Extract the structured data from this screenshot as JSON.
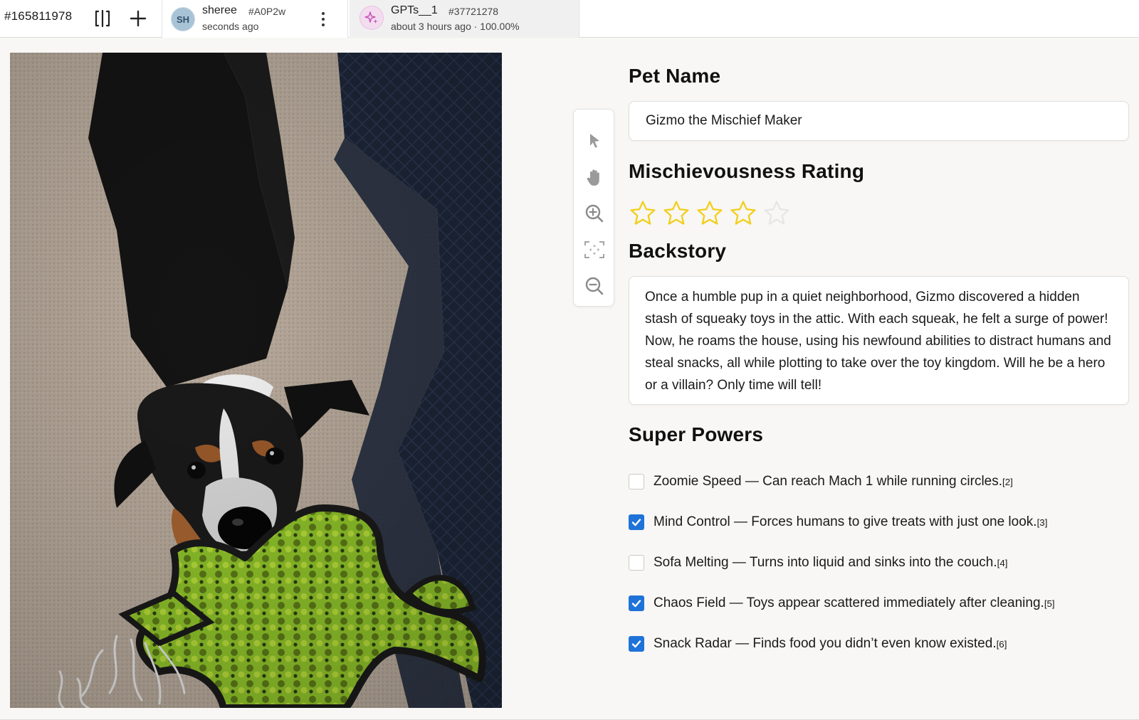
{
  "topbar": {
    "task_id": "#165811978",
    "icons": [
      "split-view-icon",
      "plus-icon"
    ],
    "tabs": [
      {
        "avatar": "SH",
        "name": "sheree",
        "hash": "#A0P2w",
        "subtitle": "seconds ago",
        "active": true
      },
      {
        "avatar_icon": "sparkle-icon",
        "name": "GPTs__1",
        "hash": "#37721278",
        "subtitle": "about 3 hours ago · 100.00%",
        "active": false
      }
    ]
  },
  "image": {
    "description": "A black, white and tan dog tugging a green spotted plush lizard toy on beige carpet"
  },
  "toolbar": {
    "tools": [
      "pointer-icon",
      "hand-icon",
      "zoom-in-icon",
      "fit-screen-icon",
      "zoom-out-icon"
    ]
  },
  "form": {
    "pet_name": {
      "label": "Pet Name",
      "value": "Gizmo the Mischief Maker"
    },
    "rating": {
      "label": "Mischievousness Rating",
      "value": 4,
      "max": 5,
      "star_color": "#f2cf1f"
    },
    "backstory": {
      "label": "Backstory",
      "value": "Once a humble pup in a quiet neighborhood, Gizmo discovered a hidden stash of squeaky toys in the attic. With each squeak, he felt a surge of power! Now, he roams the house, using his newfound abilities to distract humans and steal snacks, all while plotting to take over the toy kingdom. Will he be a hero or a villain? Only time will tell!"
    },
    "super_powers": {
      "label": "Super Powers",
      "items": [
        {
          "text": "Zoomie Speed — Can reach Mach 1 while running circles.",
          "ref": "[2]",
          "checked": false
        },
        {
          "text": "Mind Control — Forces humans to give treats with just one look.",
          "ref": "[3]",
          "checked": true
        },
        {
          "text": "Sofa Melting — Turns into liquid and sinks into the couch.",
          "ref": "[4]",
          "checked": false
        },
        {
          "text": "Chaos Field — Toys appear scattered immediately after cleaning.",
          "ref": "[5]",
          "checked": true
        },
        {
          "text": "Snack Radar — Finds food you didn’t even know existed.",
          "ref": "[6]",
          "checked": true
        }
      ]
    }
  },
  "colors": {
    "checkbox_accent": "#1f73d8",
    "star_filled": "#f2cf1f",
    "star_empty": "#e6e6e6"
  }
}
